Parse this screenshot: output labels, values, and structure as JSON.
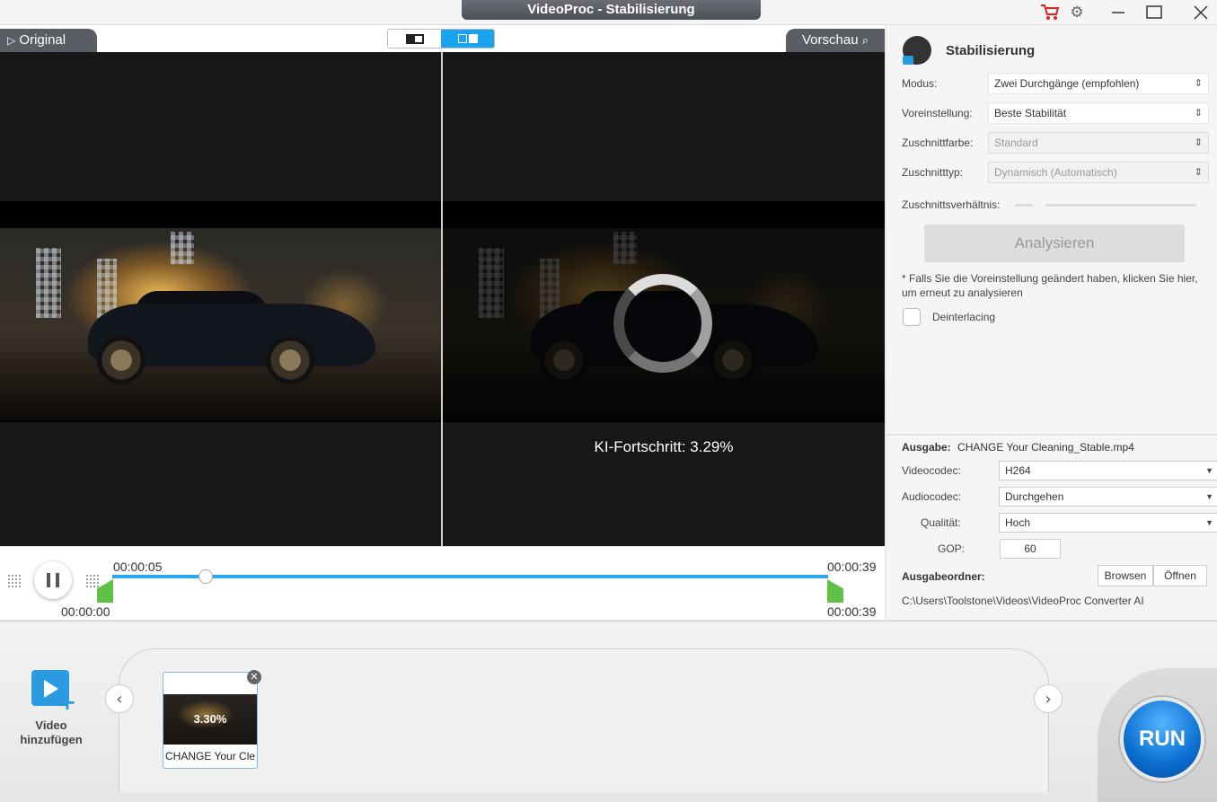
{
  "window": {
    "title": "VideoProc - Stabilisierung"
  },
  "icons": {
    "cart": "cart-icon",
    "settings": "gear-icon",
    "minimize": "minimize-icon",
    "maximize": "maximize-icon",
    "close": "close-icon",
    "search": "search-icon",
    "play": "play-icon"
  },
  "preview": {
    "original_label": "Original",
    "preview_label": "Vorschau",
    "ki_progress": "KI-Fortschritt: 3.29%"
  },
  "timeline": {
    "current_time": "00:00:05",
    "start_time": "00:00:00",
    "end_time_top": "00:00:39",
    "end_time_bottom": "00:00:39",
    "progress_fraction": 0.13
  },
  "stabilization": {
    "title": "Stabilisierung",
    "fields": [
      {
        "label": "Modus:",
        "value": "Zwei Durchgänge (empfohlen)",
        "disabled": false
      },
      {
        "label": "Voreinstellung:",
        "value": "Beste Stabilität",
        "disabled": false
      },
      {
        "label": "Zuschnittfarbe:",
        "value": "Standard",
        "disabled": true
      },
      {
        "label": "Zuschnitttyp:",
        "value": "Dynamisch (Automatisch)",
        "disabled": true
      }
    ],
    "ratio_label": "Zuschnittsverhältnis:",
    "analyze_button": "Analysieren",
    "hint": "* Falls Sie die Voreinstellung geändert haben, klicken Sie hier, um erneut zu analysieren",
    "deinterlacing_label": "Deinterlacing",
    "deinterlacing_checked": false
  },
  "output": {
    "label": "Ausgabe:",
    "filename": "CHANGE Your Cleaning_Stable.mp4",
    "videocodec_label": "Videocodec:",
    "videocodec": "H264",
    "audiocodec_label": "Audiocodec:",
    "audiocodec": "Durchgehen",
    "quality_label": "Qualität:",
    "quality": "Hoch",
    "gop_label": "GOP:",
    "gop": "60",
    "folder_label": "Ausgabeordner:",
    "browse_button": "Browsen",
    "open_button": "Öffnen",
    "folder_path": "C:\\Users\\Toolstone\\Videos\\VideoProc Converter AI"
  },
  "bottom": {
    "add_video_line1": "Video",
    "add_video_line2": "hinzufügen",
    "thumb_progress": "3.30%",
    "thumb_name": "CHANGE Your Cle",
    "run_button": "RUN"
  },
  "colors": {
    "accent": "#1aa3ee",
    "marker": "#5fc146",
    "run": "#0b6fd1",
    "cart": "#e02020"
  }
}
